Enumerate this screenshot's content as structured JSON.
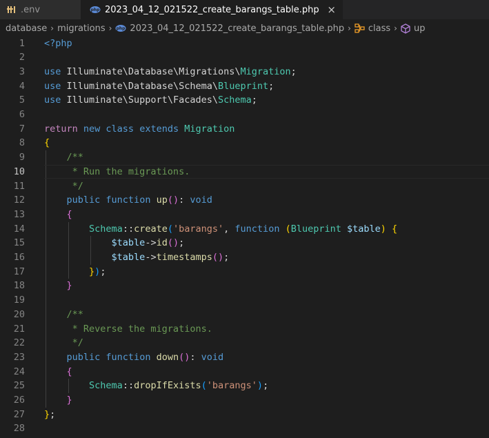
{
  "tabs": [
    {
      "label": ".env",
      "icon": "env-file-icon",
      "active": false
    },
    {
      "label": "2023_04_12_021522_create_barangs_table.php",
      "icon": "php-file-icon",
      "active": true,
      "close": "×"
    }
  ],
  "breadcrumb": {
    "items": [
      "database",
      "migrations",
      "2023_04_12_021522_create_barangs_table.php",
      "class",
      "up"
    ],
    "separator": "›"
  },
  "editor": {
    "current_line": 10,
    "lines": [
      {
        "n": "1",
        "tokens": [
          [
            "<?php",
            "tag"
          ]
        ]
      },
      {
        "n": "2",
        "tokens": []
      },
      {
        "n": "3",
        "tokens": [
          [
            "use ",
            "kw"
          ],
          [
            "Illuminate\\Database\\Migrations\\",
            "plain"
          ],
          [
            "Migration",
            "cls"
          ],
          [
            ";",
            "plain"
          ]
        ]
      },
      {
        "n": "4",
        "tokens": [
          [
            "use ",
            "kw"
          ],
          [
            "Illuminate\\Database\\Schema\\",
            "plain"
          ],
          [
            "Blueprint",
            "cls"
          ],
          [
            ";",
            "plain"
          ]
        ]
      },
      {
        "n": "5",
        "tokens": [
          [
            "use ",
            "kw"
          ],
          [
            "Illuminate\\Support\\Facades\\",
            "plain"
          ],
          [
            "Schema",
            "cls"
          ],
          [
            ";",
            "plain"
          ]
        ]
      },
      {
        "n": "6",
        "tokens": []
      },
      {
        "n": "7",
        "tokens": [
          [
            "return ",
            "ctrl"
          ],
          [
            "new ",
            "kw"
          ],
          [
            "class ",
            "kw"
          ],
          [
            "extends ",
            "kw"
          ],
          [
            "Migration",
            "cls"
          ]
        ]
      },
      {
        "n": "8",
        "tokens": [
          [
            "{",
            "b1"
          ]
        ]
      },
      {
        "n": "9",
        "tokens": [
          [
            "    /**",
            "com"
          ]
        ]
      },
      {
        "n": "10",
        "tokens": [
          [
            "     * Run the migrations.",
            "com"
          ]
        ]
      },
      {
        "n": "11",
        "tokens": [
          [
            "     */",
            "com"
          ]
        ]
      },
      {
        "n": "12",
        "tokens": [
          [
            "    ",
            "plain"
          ],
          [
            "public ",
            "kw"
          ],
          [
            "function ",
            "kw"
          ],
          [
            "up",
            "fn"
          ],
          [
            "()",
            "b2"
          ],
          [
            ": ",
            "plain"
          ],
          [
            "void",
            "kw"
          ]
        ]
      },
      {
        "n": "13",
        "tokens": [
          [
            "    ",
            "plain"
          ],
          [
            "{",
            "b2"
          ]
        ]
      },
      {
        "n": "14",
        "tokens": [
          [
            "        ",
            "plain"
          ],
          [
            "Schema",
            "cls"
          ],
          [
            "::",
            "plain"
          ],
          [
            "create",
            "fn"
          ],
          [
            "(",
            "b3"
          ],
          [
            "'barangs'",
            "str"
          ],
          [
            ", ",
            "plain"
          ],
          [
            "function ",
            "kw"
          ],
          [
            "(",
            "b1"
          ],
          [
            "Blueprint ",
            "cls"
          ],
          [
            "$table",
            "var"
          ],
          [
            ") ",
            "b1"
          ],
          [
            "{",
            "b1"
          ]
        ]
      },
      {
        "n": "15",
        "tokens": [
          [
            "            ",
            "plain"
          ],
          [
            "$table",
            "var"
          ],
          [
            "->",
            "plain"
          ],
          [
            "id",
            "fn"
          ],
          [
            "()",
            "b2"
          ],
          [
            ";",
            "plain"
          ]
        ]
      },
      {
        "n": "16",
        "tokens": [
          [
            "            ",
            "plain"
          ],
          [
            "$table",
            "var"
          ],
          [
            "->",
            "plain"
          ],
          [
            "timestamps",
            "fn"
          ],
          [
            "()",
            "b2"
          ],
          [
            ";",
            "plain"
          ]
        ]
      },
      {
        "n": "17",
        "tokens": [
          [
            "        ",
            "plain"
          ],
          [
            "}",
            "b1"
          ],
          [
            ")",
            "b3"
          ],
          [
            ";",
            "plain"
          ]
        ]
      },
      {
        "n": "18",
        "tokens": [
          [
            "    ",
            "plain"
          ],
          [
            "}",
            "b2"
          ]
        ]
      },
      {
        "n": "19",
        "tokens": []
      },
      {
        "n": "20",
        "tokens": [
          [
            "    /**",
            "com"
          ]
        ]
      },
      {
        "n": "21",
        "tokens": [
          [
            "     * Reverse the migrations.",
            "com"
          ]
        ]
      },
      {
        "n": "22",
        "tokens": [
          [
            "     */",
            "com"
          ]
        ]
      },
      {
        "n": "23",
        "tokens": [
          [
            "    ",
            "plain"
          ],
          [
            "public ",
            "kw"
          ],
          [
            "function ",
            "kw"
          ],
          [
            "down",
            "fn"
          ],
          [
            "()",
            "b2"
          ],
          [
            ": ",
            "plain"
          ],
          [
            "void",
            "kw"
          ]
        ]
      },
      {
        "n": "24",
        "tokens": [
          [
            "    ",
            "plain"
          ],
          [
            "{",
            "b2"
          ]
        ]
      },
      {
        "n": "25",
        "tokens": [
          [
            "        ",
            "plain"
          ],
          [
            "Schema",
            "cls"
          ],
          [
            "::",
            "plain"
          ],
          [
            "dropIfExists",
            "fn"
          ],
          [
            "(",
            "b3"
          ],
          [
            "'barangs'",
            "str"
          ],
          [
            ")",
            "b3"
          ],
          [
            ";",
            "plain"
          ]
        ]
      },
      {
        "n": "26",
        "tokens": [
          [
            "    ",
            "plain"
          ],
          [
            "}",
            "b2"
          ]
        ]
      },
      {
        "n": "27",
        "tokens": [
          [
            "}",
            "b1"
          ],
          [
            ";",
            "plain"
          ]
        ]
      },
      {
        "n": "28",
        "tokens": []
      }
    ]
  }
}
